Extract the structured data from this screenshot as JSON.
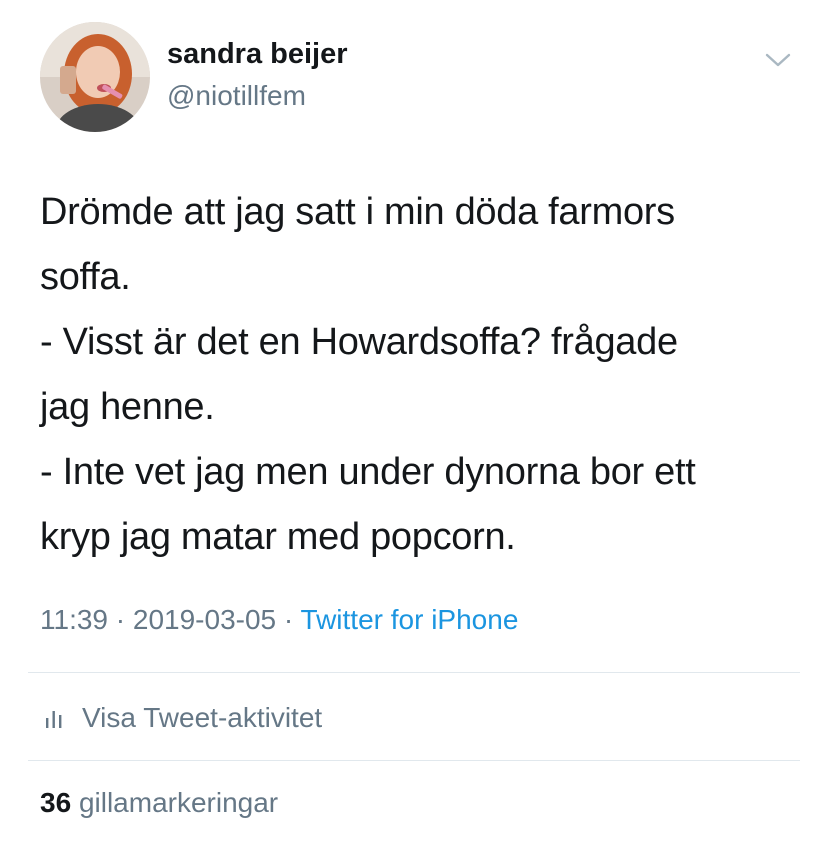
{
  "tweet": {
    "author": {
      "name": "sandra beijer",
      "handle": "@niotillfem"
    },
    "text": "Drömde att jag satt i min döda farmors\nsoffa.\n- Visst är det en Howardsoffa? frågade\njag henne.\n- Inte vet jag men under dynorna bor ett\nkryp jag matar med popcorn.",
    "time": "11:39",
    "separator": "·",
    "date": "2019-03-05",
    "source": "Twitter for iPhone"
  },
  "activity": {
    "icon": "analytics-bars-icon",
    "label": "Visa Tweet-aktivitet"
  },
  "likes": {
    "count": "36",
    "label": "gillamarkeringar"
  },
  "colors": {
    "text": "#14171a",
    "secondary": "#657786",
    "link": "#1b95e0",
    "divider": "#e1e8ed"
  }
}
